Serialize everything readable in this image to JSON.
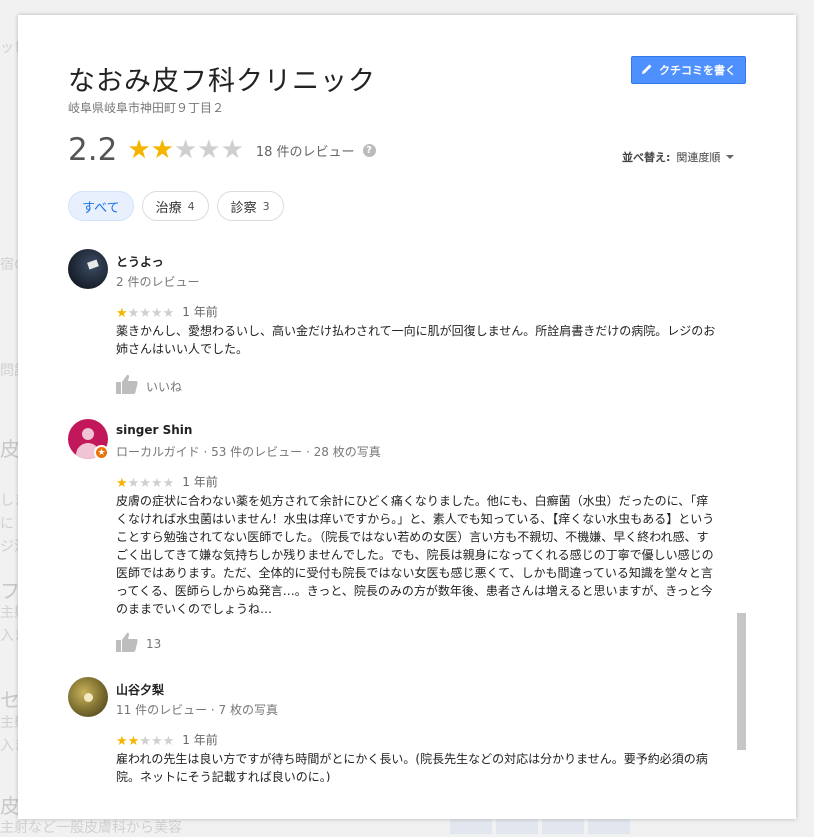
{
  "colors": {
    "accent": "#4d90fe",
    "star_on": "#f4b400",
    "star_off": "#cfcfcf",
    "chip_active_bg": "#e8f0fe",
    "chip_active_text": "#1a73e8"
  },
  "background": {
    "fragments": [
      "ッピ",
      "宿の",
      "問診",
      "皮フ",
      "しま",
      "に",
      "ジ法",
      "フ",
      "主射",
      "入ま",
      "セ",
      "主射",
      "入ま",
      "皮",
      "主射など一般皮膚科から美容"
    ]
  },
  "dialog": {
    "clinic_name": "なおみ皮フ科クリニック",
    "address": "岐阜県岐阜市神田町９丁目２",
    "write_review_button": {
      "label": "クチコミを書く",
      "icon": "pencil-icon"
    },
    "rating": {
      "value": "2.2",
      "stars": 2.2,
      "review_count_text": "18 件のレビュー",
      "help_icon": "question-icon"
    },
    "sort": {
      "label": "並べ替え:",
      "value": "関連度順"
    },
    "filters": [
      {
        "label": "すべて",
        "count": "",
        "active": true
      },
      {
        "label": "治療",
        "count": "4",
        "active": false
      },
      {
        "label": "診察",
        "count": "3",
        "active": false
      }
    ],
    "reviews": [
      {
        "name": "とうよっ",
        "meta": "2 件のレビュー",
        "stars": 1,
        "date": "1 年前",
        "text": "薬きかんし、愛想わるいし、高い金だけ払わされて一向に肌が回復しません。所詮肩書きだけの病院。レジのお姉さんはいい人でした。",
        "like_label": "いいね"
      },
      {
        "name": "singer Shin",
        "meta": "ローカルガイド · 53 件のレビュー · 28 枚の写真",
        "stars": 1,
        "date": "1 年前",
        "text": "皮膚の症状に合わない薬を処方されて余計にひどく痛くなりました。他にも、白癬菌（水虫）だったのに、「痒くなければ水虫菌はいません！水虫は痒いですから。」と、素人でも知っている、【痒くない水虫もある】ということすら勉強されてない医師でした。（院長ではない若めの女医）言い方も不親切、不機嫌、早く終われ感、すごく出してきて嫌な気持ちしか残りませんでした。でも、院長は親身になってくれる感じの丁寧で優しい感じの医師ではあります。ただ、全体的に受付も院長ではない女医も感じ悪くて、しかも間違っている知識を堂々と言ってくる、医師らしからぬ発言…。きっと、院長のみの方が数年後、患者さんは増えると思いますが、きっと今のままでいくのでしょうね…",
        "like_label": "13"
      },
      {
        "name": "山谷夕梨",
        "meta": "11 件のレビュー · 7 枚の写真",
        "stars": 2,
        "date": "1 年前",
        "text": "雇われの先生は良い方ですが待ち時間がとにかく長い。(院長先生などの対応は分かりません。要予約必須の病院。ネットにそう記載すれば良いのに。)",
        "like_label": ""
      }
    ]
  }
}
